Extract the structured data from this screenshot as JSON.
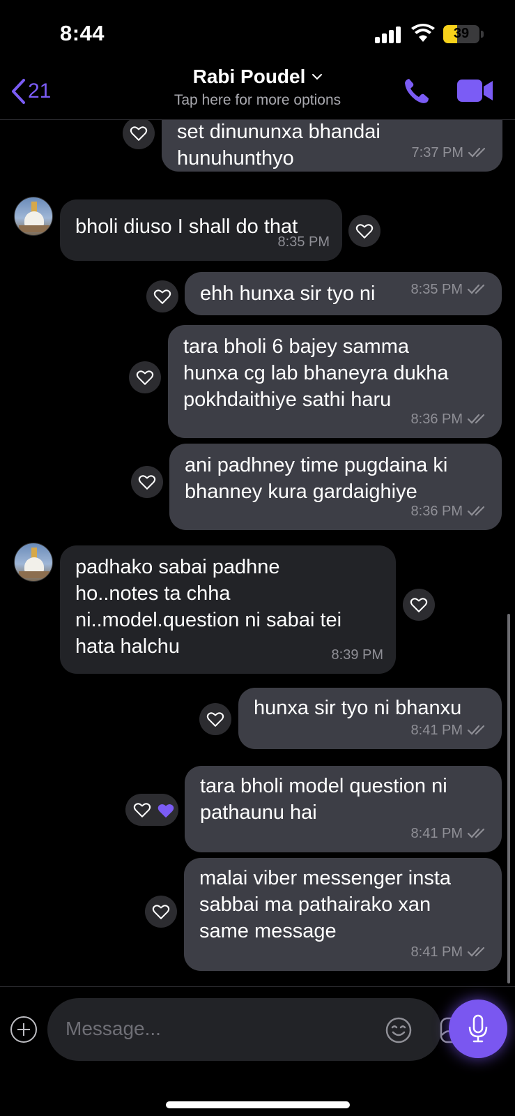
{
  "status_bar": {
    "time": "8:44",
    "battery": "39",
    "battery_level": 0.39
  },
  "header": {
    "back_count": "21",
    "contact_name": "Rabi Poudel",
    "subtitle": "Tap here for more options"
  },
  "messages": [
    {
      "dir": "out",
      "text": "set dinununxa bhandai\nhunuhunthyo",
      "time": "7:37 PM",
      "read": true
    },
    {
      "dir": "in",
      "text": "bholi diuso I shall do that",
      "time": "8:35 PM"
    },
    {
      "dir": "out",
      "text": "ehh hunxa sir tyo ni",
      "time": "8:35 PM",
      "read": true
    },
    {
      "dir": "out",
      "text": "tara bholi 6 bajey samma\nhunxa cg lab bhaneyra dukha\npokhdaithiye sathi haru",
      "time": "8:36 PM",
      "read": true
    },
    {
      "dir": "out",
      "text": "ani padhney time pugdaina ki\nbhanney kura gardaighiye",
      "time": "8:36 PM",
      "read": true
    },
    {
      "dir": "in",
      "text": "padhako sabai padhne\nho..notes ta chha\nni..model.question ni sabai tei\nhata halchu",
      "time": "8:39 PM"
    },
    {
      "dir": "out",
      "text": "hunxa sir tyo ni bhanxu",
      "time": "8:41 PM",
      "read": true
    },
    {
      "dir": "out",
      "text": "tara bholi model question ni\npathaunu hai",
      "time": "8:41 PM",
      "read": true,
      "reaction": "purple-heart"
    },
    {
      "dir": "out",
      "text": "malai viber messenger insta\nsabbai ma pathairako xan\nsame message",
      "time": "8:41 PM",
      "read": true
    }
  ],
  "composer": {
    "placeholder": "Message..."
  },
  "colors": {
    "accent": "#7b5cf5",
    "outgoing_bubble": "#3d3e46",
    "incoming_bubble": "#222327"
  }
}
